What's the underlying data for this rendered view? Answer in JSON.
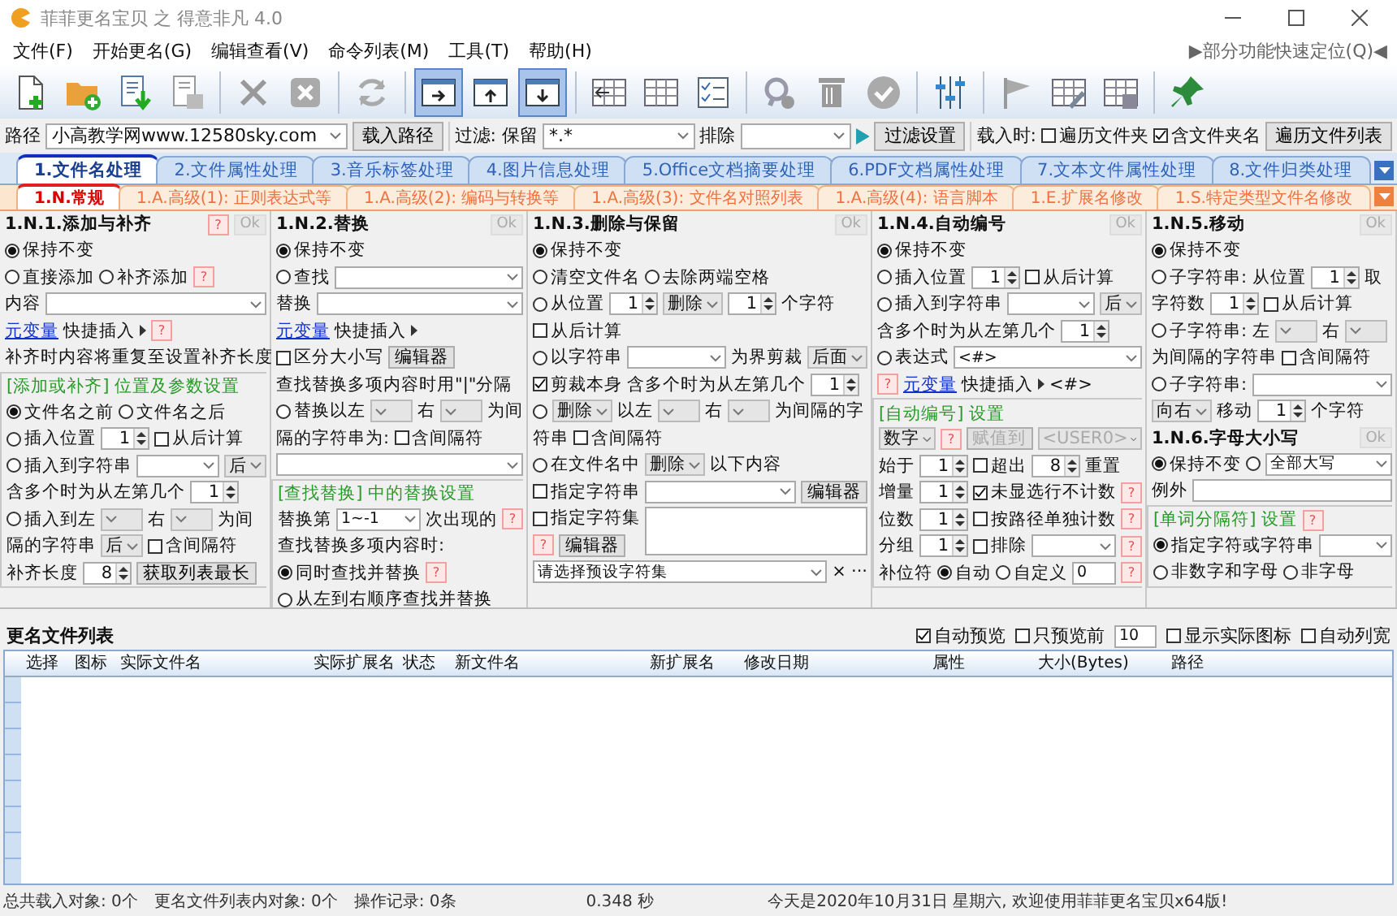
{
  "window": {
    "title": "菲菲更名宝贝 之 得意非凡 4.0"
  },
  "menu": [
    "文件(F)",
    "开始更名(G)",
    "编辑查看(V)",
    "命令列表(M)",
    "工具(T)",
    "帮助(H)"
  ],
  "quick_locate": "▶部分功能快速定位(Q)◀",
  "toolbar": [
    {
      "kind": "new-file",
      "pressed": false
    },
    {
      "kind": "add-folder",
      "pressed": false
    },
    {
      "kind": "import-list",
      "pressed": false
    },
    {
      "kind": "save-list",
      "pressed": false
    },
    {
      "kind": "separator"
    },
    {
      "kind": "delete",
      "pressed": false
    },
    {
      "kind": "clear",
      "pressed": false
    },
    {
      "kind": "separator"
    },
    {
      "kind": "refresh",
      "pressed": false
    },
    {
      "kind": "separator"
    },
    {
      "kind": "layout-right",
      "pressed": true
    },
    {
      "kind": "layout-up",
      "pressed": false
    },
    {
      "kind": "layout-down",
      "pressed": true
    },
    {
      "kind": "separator"
    },
    {
      "kind": "grid-insert",
      "pressed": false
    },
    {
      "kind": "grid",
      "pressed": false
    },
    {
      "kind": "checklist",
      "pressed": false
    },
    {
      "kind": "separator"
    },
    {
      "kind": "search-check",
      "pressed": false
    },
    {
      "kind": "trash",
      "pressed": false
    },
    {
      "kind": "check-circle",
      "pressed": false
    },
    {
      "kind": "separator"
    },
    {
      "kind": "sliders",
      "pressed": false
    },
    {
      "kind": "separator"
    },
    {
      "kind": "flag",
      "pressed": false
    },
    {
      "kind": "table-edit",
      "pressed": false
    },
    {
      "kind": "table-save",
      "pressed": false
    },
    {
      "kind": "separator"
    },
    {
      "kind": "pin",
      "pressed": false
    }
  ],
  "path_bar": {
    "label": "路径",
    "path": "小高教学网www.12580sky.com",
    "load_button": "载入路径",
    "filter_label": "过滤: 保留",
    "filter": "*.*",
    "exclude_label": "排除",
    "filter_button": "过滤设置",
    "on_load_label": "载入时:",
    "checks": [
      {
        "label": "遍历文件夹",
        "checked": false
      },
      {
        "label": "含文件夹名",
        "checked": true
      }
    ],
    "list_button": "遍历文件列表"
  },
  "tabs": [
    {
      "label": "1.文件名处理",
      "selected": true
    },
    {
      "label": "2.文件属性处理",
      "selected": false
    },
    {
      "label": "3.音乐标签处理",
      "selected": false
    },
    {
      "label": "4.图片信息处理",
      "selected": false
    },
    {
      "label": "5.Office文档摘要处理",
      "selected": false
    },
    {
      "label": "6.PDF文档属性处理",
      "selected": false
    },
    {
      "label": "7.文本文件属性处理",
      "selected": false
    },
    {
      "label": "8.文件归类处理",
      "selected": false
    }
  ],
  "sub_tabs": [
    {
      "label": "1.N.常规",
      "selected": true
    },
    {
      "label": "1.A.高级(1): 正则表达式等",
      "selected": false
    },
    {
      "label": "1.A.高级(2): 编码与转换等",
      "selected": false
    },
    {
      "label": "1.A.高级(3): 文件名对照列表",
      "selected": false
    },
    {
      "label": "1.A.高级(4): 语言脚本",
      "selected": false
    },
    {
      "label": "1.E.扩展名修改",
      "selected": false
    },
    {
      "label": "1.S.特定类型文件名修改",
      "selected": false
    }
  ],
  "columns": [
    {
      "panels": [
        {
          "title": "1.N.1.添加与补齐",
          "help": "?",
          "ok": "Ok",
          "rows": [
            {
              "kind": "row",
              "items": [
                {
                  "kind": "radio",
                  "label": "保持不变",
                  "selected": true
                }
              ]
            },
            {
              "kind": "row",
              "items": [
                {
                  "kind": "radio",
                  "label": "直接添加",
                  "selected": false
                },
                {
                  "kind": "radio",
                  "label": "补齐添加",
                  "selected": false
                },
                {
                  "kind": "help",
                  "label": "?"
                }
              ]
            },
            {
              "kind": "row",
              "items": [
                {
                  "kind": "text",
                  "label": "内容"
                },
                {
                  "kind": "combo"
                }
              ]
            },
            {
              "kind": "row",
              "items": [
                {
                  "kind": "link",
                  "label": "元变量"
                },
                {
                  "kind": "menu",
                  "label": "快捷插入"
                },
                {
                  "kind": "help",
                  "label": "?"
                }
              ]
            },
            {
              "kind": "row",
              "items": [
                {
                  "kind": "text",
                  "label": "补齐时内容将重复至设置补齐长度"
                }
              ]
            },
            {
              "kind": "section",
              "title": "[添加或补齐] 位置及参数设置",
              "rows": [
                {
                  "kind": "row",
                  "items": [
                    {
                      "kind": "radio",
                      "label": "文件名之前",
                      "selected": true
                    },
                    {
                      "kind": "radio",
                      "label": "文件名之后",
                      "selected": false
                    }
                  ]
                },
                {
                  "kind": "row",
                  "items": [
                    {
                      "kind": "radio",
                      "label": "插入位置",
                      "selected": false
                    },
                    {
                      "kind": "spin",
                      "value": "1"
                    },
                    {
                      "kind": "check",
                      "label": "从后计算",
                      "checked": false
                    }
                  ]
                },
                {
                  "kind": "row",
                  "items": [
                    {
                      "kind": "radio",
                      "label": "插入到字符串",
                      "selected": false
                    },
                    {
                      "kind": "combo"
                    },
                    {
                      "kind": "select",
                      "value": "后"
                    }
                  ]
                },
                {
                  "kind": "row",
                  "items": [
                    {
                      "kind": "text",
                      "label": "含多个时为从左第几个"
                    },
                    {
                      "kind": "spin",
                      "value": "1"
                    }
                  ]
                },
                {
                  "kind": "row",
                  "items": [
                    {
                      "kind": "radio",
                      "label": "插入到左",
                      "selected": false
                    },
                    {
                      "kind": "select"
                    },
                    {
                      "kind": "text",
                      "label": "右"
                    },
                    {
                      "kind": "select"
                    },
                    {
                      "kind": "text",
                      "label": "为间"
                    }
                  ]
                },
                {
                  "kind": "row",
                  "items": [
                    {
                      "kind": "text",
                      "label": "隔的字符串"
                    },
                    {
                      "kind": "select",
                      "value": "后"
                    },
                    {
                      "kind": "check",
                      "label": "含间隔符",
                      "checked": false
                    }
                  ]
                },
                {
                  "kind": "row",
                  "items": [
                    {
                      "kind": "text",
                      "label": "补齐长度"
                    },
                    {
                      "kind": "spin",
                      "value": "8"
                    },
                    {
                      "kind": "button",
                      "label": "获取列表最长"
                    }
                  ]
                }
              ]
            }
          ]
        }
      ]
    },
    {
      "panels": [
        {
          "title": "1.N.2.替换",
          "ok": "Ok",
          "rows": [
            {
              "kind": "row",
              "items": [
                {
                  "kind": "radio",
                  "label": "保持不变",
                  "selected": true
                }
              ]
            },
            {
              "kind": "row",
              "items": [
                {
                  "kind": "radio",
                  "label": "查找",
                  "selected": false
                },
                {
                  "kind": "combo"
                }
              ]
            },
            {
              "kind": "row",
              "items": [
                {
                  "kind": "text",
                  "label": "替换"
                },
                {
                  "kind": "combo"
                }
              ]
            },
            {
              "kind": "row",
              "items": [
                {
                  "kind": "link",
                  "label": "元变量"
                },
                {
                  "kind": "menu",
                  "label": "快捷插入"
                }
              ]
            },
            {
              "kind": "row",
              "items": [
                {
                  "kind": "check",
                  "label": "区分大小写",
                  "checked": false
                },
                {
                  "kind": "button",
                  "label": "编辑器"
                }
              ]
            },
            {
              "kind": "row",
              "items": [
                {
                  "kind": "text",
                  "label": "查找替换多项内容时用\"|\"分隔"
                }
              ]
            },
            {
              "kind": "row",
              "items": [
                {
                  "kind": "radio",
                  "label": "替换以左",
                  "selected": false
                },
                {
                  "kind": "select"
                },
                {
                  "kind": "text",
                  "label": "右"
                },
                {
                  "kind": "select"
                },
                {
                  "kind": "text",
                  "label": "为间"
                }
              ]
            },
            {
              "kind": "row",
              "items": [
                {
                  "kind": "text",
                  "label": "隔的字符串为:"
                },
                {
                  "kind": "check",
                  "label": "含间隔符",
                  "checked": false
                }
              ]
            },
            {
              "kind": "row",
              "items": [
                {
                  "kind": "combo"
                }
              ]
            },
            {
              "kind": "section",
              "title": "[查找替换] 中的替换设置",
              "rows": [
                {
                  "kind": "row",
                  "items": [
                    {
                      "kind": "text",
                      "label": "替换第"
                    },
                    {
                      "kind": "combo",
                      "value": "1~-1"
                    },
                    {
                      "kind": "text",
                      "label": "次出现的"
                    },
                    {
                      "kind": "help",
                      "label": "?"
                    }
                  ]
                },
                {
                  "kind": "row",
                  "items": [
                    {
                      "kind": "text",
                      "label": "查找替换多项内容时:"
                    }
                  ]
                },
                {
                  "kind": "row",
                  "items": [
                    {
                      "kind": "radio",
                      "label": "同时查找并替换",
                      "selected": true
                    },
                    {
                      "kind": "help",
                      "label": "?"
                    }
                  ]
                },
                {
                  "kind": "row",
                  "items": [
                    {
                      "kind": "radio",
                      "label": "从左到右顺序查找并替换",
                      "selected": false
                    }
                  ]
                }
              ]
            }
          ]
        }
      ]
    },
    {
      "panels": [
        {
          "title": "1.N.3.删除与保留",
          "ok": "Ok",
          "rows": [
            {
              "kind": "row",
              "items": [
                {
                  "kind": "radio",
                  "label": "保持不变",
                  "selected": true
                }
              ]
            },
            {
              "kind": "row",
              "items": [
                {
                  "kind": "radio",
                  "label": "清空文件名",
                  "selected": false
                },
                {
                  "kind": "radio",
                  "label": "去除两端空格",
                  "selected": false
                }
              ]
            },
            {
              "kind": "row",
              "items": [
                {
                  "kind": "radio",
                  "label": "从位置",
                  "selected": false
                },
                {
                  "kind": "spin",
                  "value": "1"
                },
                {
                  "kind": "select",
                  "value": "删除"
                },
                {
                  "kind": "spin",
                  "value": "1"
                },
                {
                  "kind": "text",
                  "label": "个字符"
                }
              ]
            },
            {
              "kind": "row",
              "items": [
                {
                  "kind": "check",
                  "label": "从后计算",
                  "checked": false
                }
              ]
            },
            {
              "kind": "row",
              "items": [
                {
                  "kind": "radio",
                  "label": "以字符串",
                  "selected": false
                },
                {
                  "kind": "combo"
                },
                {
                  "kind": "text",
                  "label": "为界剪裁"
                },
                {
                  "kind": "select",
                  "value": "后面"
                }
              ]
            },
            {
              "kind": "row",
              "items": [
                {
                  "kind": "check",
                  "label": "剪裁本身",
                  "checked": true
                },
                {
                  "kind": "text",
                  "label": "含多个时为从左第几个"
                },
                {
                  "kind": "spin",
                  "value": "1"
                }
              ]
            },
            {
              "kind": "row",
              "items": [
                {
                  "kind": "radio",
                  "selected": false
                },
                {
                  "kind": "select",
                  "value": "删除"
                },
                {
                  "kind": "text",
                  "label": "以左"
                },
                {
                  "kind": "select"
                },
                {
                  "kind": "text",
                  "label": "右"
                },
                {
                  "kind": "select"
                },
                {
                  "kind": "text",
                  "label": "为间隔的字"
                }
              ]
            },
            {
              "kind": "row",
              "items": [
                {
                  "kind": "text",
                  "label": "符串"
                },
                {
                  "kind": "check",
                  "label": "含间隔符",
                  "checked": false
                }
              ]
            },
            {
              "kind": "row",
              "items": [
                {
                  "kind": "radio",
                  "label": "在文件名中",
                  "selected": false
                },
                {
                  "kind": "select",
                  "value": "删除"
                },
                {
                  "kind": "text",
                  "label": "以下内容"
                }
              ]
            },
            {
              "kind": "row",
              "items": [
                {
                  "kind": "check",
                  "label": "指定字符串",
                  "checked": false
                },
                {
                  "kind": "combo"
                },
                {
                  "kind": "button",
                  "label": "编辑器"
                }
              ]
            },
            {
              "kind": "row",
              "items": [
                {
                  "kind": "check",
                  "label": "指定字符集",
                  "checked": false
                },
                {
                  "kind": "listbox"
                }
              ]
            },
            {
              "kind": "row",
              "items": [
                {
                  "kind": "help",
                  "label": "?"
                },
                {
                  "kind": "button",
                  "label": "编辑器"
                }
              ]
            },
            {
              "kind": "row",
              "items": [
                {
                  "kind": "combo",
                  "value": "请选择预设字符集"
                },
                {
                  "kind": "text",
                  "label": "×"
                },
                {
                  "kind": "text",
                  "label": "···"
                }
              ]
            }
          ]
        }
      ]
    },
    {
      "panels": [
        {
          "title": "1.N.4.自动编号",
          "ok": "Ok",
          "rows": [
            {
              "kind": "row",
              "items": [
                {
                  "kind": "radio",
                  "label": "保持不变",
                  "selected": true
                }
              ]
            },
            {
              "kind": "row",
              "items": [
                {
                  "kind": "radio",
                  "label": "插入位置",
                  "selected": false
                },
                {
                  "kind": "spin",
                  "value": "1"
                },
                {
                  "kind": "check",
                  "label": "从后计算",
                  "checked": false
                }
              ]
            },
            {
              "kind": "row",
              "items": [
                {
                  "kind": "radio",
                  "label": "插入到字符串",
                  "selected": false
                },
                {
                  "kind": "combo"
                },
                {
                  "kind": "select",
                  "value": "后"
                }
              ]
            },
            {
              "kind": "row",
              "items": [
                {
                  "kind": "text",
                  "label": "含多个时为从左第几个"
                },
                {
                  "kind": "spin",
                  "value": "1"
                }
              ]
            },
            {
              "kind": "row",
              "items": [
                {
                  "kind": "radio",
                  "label": "表达式",
                  "selected": false
                },
                {
                  "kind": "combo",
                  "value": "<#>"
                }
              ]
            },
            {
              "kind": "row",
              "items": [
                {
                  "kind": "help",
                  "label": "?"
                },
                {
                  "kind": "link",
                  "label": "元变量"
                },
                {
                  "kind": "menu",
                  "label": "快捷插入"
                },
                {
                  "kind": "text",
                  "label": "<#>"
                }
              ]
            },
            {
              "kind": "section",
              "title": "[自动编号] 设置",
              "rows": [
                {
                  "kind": "row",
                  "items": [
                    {
                      "kind": "select",
                      "value": "数字"
                    },
                    {
                      "kind": "help",
                      "label": "?"
                    },
                    {
                      "kind": "button",
                      "label": "赋值到",
                      "disabled": true
                    },
                    {
                      "kind": "select",
                      "value": "<USER0>",
                      "disabled": true
                    }
                  ]
                },
                {
                  "kind": "row",
                  "items": [
                    {
                      "kind": "text",
                      "label": "始于"
                    },
                    {
                      "kind": "spin",
                      "value": "1"
                    },
                    {
                      "kind": "check",
                      "label": "超出",
                      "checked": false
                    },
                    {
                      "kind": "spin",
                      "value": "8"
                    },
                    {
                      "kind": "text",
                      "label": "重置"
                    }
                  ]
                },
                {
                  "kind": "row",
                  "items": [
                    {
                      "kind": "text",
                      "label": "增量"
                    },
                    {
                      "kind": "spin",
                      "value": "1"
                    },
                    {
                      "kind": "check",
                      "label": "未显选行不计数",
                      "checked": true
                    },
                    {
                      "kind": "help",
                      "label": "?"
                    }
                  ]
                },
                {
                  "kind": "row",
                  "items": [
                    {
                      "kind": "text",
                      "label": "位数"
                    },
                    {
                      "kind": "spin",
                      "value": "1"
                    },
                    {
                      "kind": "check",
                      "label": "按路径单独计数",
                      "checked": false
                    },
                    {
                      "kind": "help",
                      "label": "?"
                    }
                  ]
                },
                {
                  "kind": "row",
                  "items": [
                    {
                      "kind": "text",
                      "label": "分组"
                    },
                    {
                      "kind": "spin",
                      "value": "1"
                    },
                    {
                      "kind": "check",
                      "label": "排除",
                      "checked": false
                    },
                    {
                      "kind": "combo"
                    },
                    {
                      "kind": "help",
                      "label": "?"
                    }
                  ]
                },
                {
                  "kind": "row",
                  "items": [
                    {
                      "kind": "text",
                      "label": "补位符"
                    },
                    {
                      "kind": "radio",
                      "label": "自动",
                      "selected": true
                    },
                    {
                      "kind": "radio",
                      "label": "自定义",
                      "selected": false
                    },
                    {
                      "kind": "input",
                      "value": "0"
                    },
                    {
                      "kind": "help",
                      "label": "?"
                    }
                  ]
                }
              ]
            }
          ]
        }
      ]
    },
    {
      "panels": [
        {
          "title": "1.N.5.移动",
          "ok": "Ok",
          "rows": [
            {
              "kind": "row",
              "items": [
                {
                  "kind": "radio",
                  "label": "保持不变",
                  "selected": true
                }
              ]
            },
            {
              "kind": "row",
              "items": [
                {
                  "kind": "radio",
                  "label": "子字符串: 从位置",
                  "selected": false
                },
                {
                  "kind": "spin",
                  "value": "1"
                },
                {
                  "kind": "text",
                  "label": "取"
                }
              ]
            },
            {
              "kind": "row",
              "items": [
                {
                  "kind": "text",
                  "label": "字符数"
                },
                {
                  "kind": "spin",
                  "value": "1"
                },
                {
                  "kind": "check",
                  "label": "从后计算",
                  "checked": false
                }
              ]
            },
            {
              "kind": "row",
              "items": [
                {
                  "kind": "radio",
                  "label": "子字符串: 左",
                  "selected": false
                },
                {
                  "kind": "select"
                },
                {
                  "kind": "text",
                  "label": "右"
                },
                {
                  "kind": "select"
                }
              ]
            },
            {
              "kind": "row",
              "items": [
                {
                  "kind": "text",
                  "label": "为间隔的字符串"
                },
                {
                  "kind": "check",
                  "label": "含间隔符",
                  "checked": false
                }
              ]
            },
            {
              "kind": "row",
              "items": [
                {
                  "kind": "radio",
                  "label": "子字符串:",
                  "selected": false
                },
                {
                  "kind": "combo"
                }
              ]
            },
            {
              "kind": "row",
              "items": [
                {
                  "kind": "select",
                  "value": "向右"
                },
                {
                  "kind": "text",
                  "label": "移动"
                },
                {
                  "kind": "spin",
                  "value": "1"
                },
                {
                  "kind": "text",
                  "label": "个字符"
                }
              ]
            }
          ]
        },
        {
          "title": "1.N.6.字母大小写",
          "ok": "Ok",
          "rows": [
            {
              "kind": "row",
              "items": [
                {
                  "kind": "radio",
                  "label": "保持不变",
                  "selected": true
                },
                {
                  "kind": "radio",
                  "selected": false
                },
                {
                  "kind": "combo",
                  "value": "全部大写"
                }
              ]
            },
            {
              "kind": "row",
              "items": [
                {
                  "kind": "text",
                  "label": "例外"
                },
                {
                  "kind": "input"
                }
              ]
            },
            {
              "kind": "section",
              "title": "[单词分隔符] 设置",
              "help": "?",
              "rows": [
                {
                  "kind": "row",
                  "items": [
                    {
                      "kind": "radio",
                      "label": "指定字符或字符串",
                      "selected": true
                    },
                    {
                      "kind": "combo"
                    }
                  ]
                },
                {
                  "kind": "row",
                  "items": [
                    {
                      "kind": "radio",
                      "label": "非数字和字母",
                      "selected": false
                    },
                    {
                      "kind": "radio",
                      "label": "非字母",
                      "selected": false
                    }
                  ]
                }
              ]
            }
          ]
        }
      ]
    }
  ],
  "file_list": {
    "title": "更名文件列表",
    "options": [
      {
        "kind": "check",
        "label": "自动预览",
        "checked": true
      },
      {
        "kind": "check",
        "label": "只预览前",
        "checked": false
      },
      {
        "kind": "input",
        "value": "10"
      },
      {
        "kind": "check",
        "label": "显示实际图标",
        "checked": false
      },
      {
        "kind": "check",
        "label": "自动列宽",
        "checked": false
      }
    ],
    "columns": [
      "选择",
      "图标",
      "实际文件名",
      "实际扩展名",
      "状态",
      "新文件名",
      "新扩展名",
      "修改日期",
      "属性",
      "大小(Bytes)",
      "路径"
    ]
  },
  "status_bar": [
    "总共载入对象: 0个",
    "更名文件列表内对象: 0个",
    "操作记录: 0条",
    "0.348 秒",
    "今天是2020年10月31日 星期六, 欢迎使用菲菲更名宝贝x64版!"
  ]
}
